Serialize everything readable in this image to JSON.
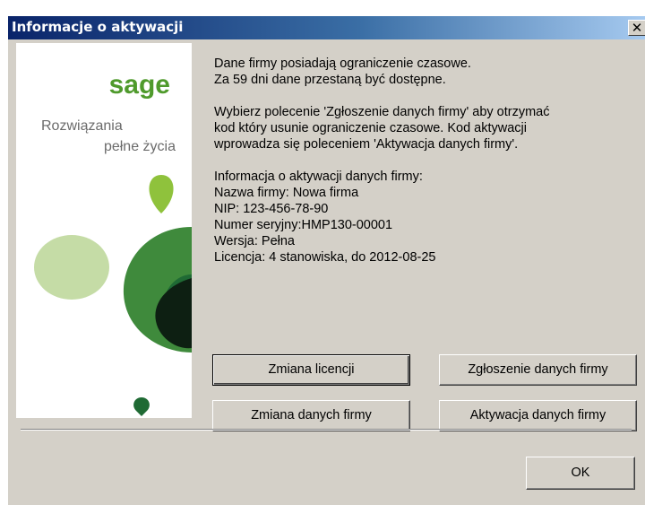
{
  "window": {
    "title": "Informacje o aktywacji",
    "close_glyph": "✕"
  },
  "banner": {
    "logo": "sage",
    "tagline_line1": "Rozwiązania",
    "tagline_line2": "pełne życia",
    "colors": {
      "logo_green": "#4f9a2c",
      "light_green": "#8fc23c",
      "pale_green": "#c5dca6",
      "mid_green": "#3f8a3c",
      "dark_green": "#1f6a34",
      "darkest": "#0d1f12"
    }
  },
  "message": {
    "para1": [
      "Dane firmy posiadają ograniczenie czasowe.",
      "Za 59 dni dane przestaną być dostępne."
    ],
    "para2": [
      "Wybierz polecenie 'Zgłoszenie danych firmy' aby otrzymać",
      "kod który usunie ograniczenie czasowe. Kod aktywacji",
      "wprowadza się poleceniem 'Aktywacja danych firmy'."
    ],
    "info_heading": "Informacja o aktywacji danych firmy:",
    "company_name": "Nazwa firmy: Nowa firma",
    "nip": "NIP: 123-456-78-90",
    "serial": "Numer seryjny:HMP130-00001",
    "version": "Wersja: Pełna",
    "license": "Licencja: 4 stanowiska, do 2012-08-25"
  },
  "buttons": {
    "change_license": "Zmiana licencji",
    "submit_company_data": "Zgłoszenie danych firmy",
    "change_company_data": "Zmiana danych firmy",
    "activate_company_data": "Aktywacja danych firmy",
    "ok": "OK"
  }
}
